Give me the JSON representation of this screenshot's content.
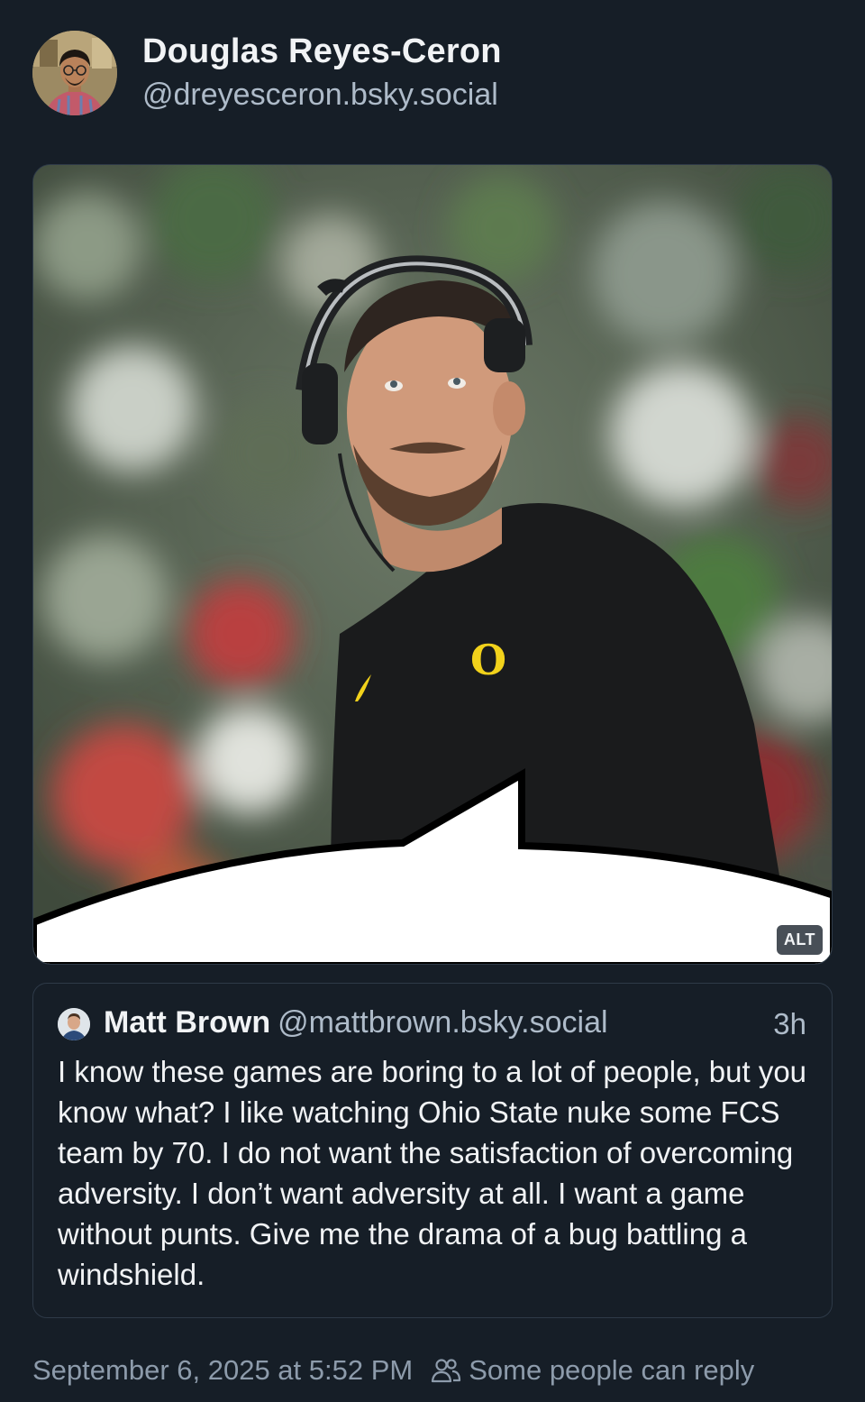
{
  "author": {
    "display_name": "Douglas Reyes-Ceron",
    "handle": "@dreyesceron.bsky.social",
    "avatar_icon": "author-avatar"
  },
  "image": {
    "alt_badge": "ALT",
    "subject_icon": "coach-photo-with-speech-bubble",
    "shirt_logo": "O"
  },
  "quote": {
    "author_name": "Matt Brown",
    "author_handle": "@mattbrown.bsky.social",
    "time": "3h",
    "text": "I know these games are boring to a lot of people, but you know what? I like watching Ohio State nuke some FCS team by 70. I do not want the satisfaction of overcoming adversity. I don’t want adversity at all. I want a game without punts. Give me the drama of a bug battling a windshield."
  },
  "meta": {
    "timestamp": "September 6, 2025 at 5:52 PM",
    "reply_setting": "Some people can reply",
    "reply_icon": "people-icon"
  },
  "colors": {
    "background": "#161e27",
    "text_primary": "#f1f3f5",
    "text_secondary": "#aebbc9",
    "border": "#2e3a48",
    "shirt_logo_yellow": "#f2d21b"
  }
}
